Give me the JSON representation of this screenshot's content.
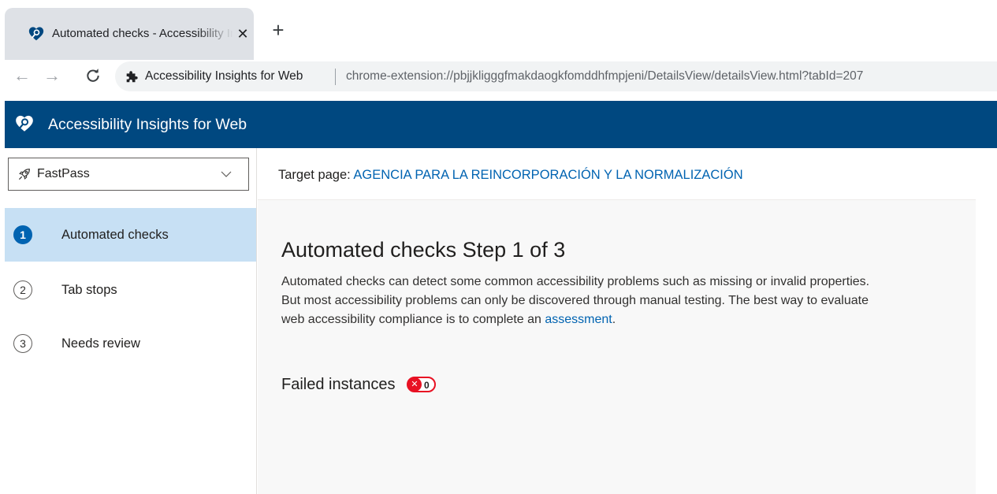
{
  "browser": {
    "tab": {
      "title": "Automated checks - Accessibility Insights for Web",
      "close": "✕",
      "favicon": "accessibility-insights-logo-icon"
    },
    "new_tab": "+",
    "nav": {
      "back": "←",
      "forward": "→",
      "reload": "C"
    },
    "omnibox": {
      "site_name": "Accessibility Insights for Web",
      "url": "chrome-extension://pbjjkligggfmakdaogkfomddhfmpjeni/DetailsView/detailsView.html?tabId=207",
      "icon": "puzzle-extension-icon"
    }
  },
  "app": {
    "title": "Accessibility Insights for Web",
    "header_color": "#004880"
  },
  "sidebar": {
    "dropdown": {
      "label": "FastPass",
      "icon": "rocket-icon"
    },
    "items": [
      {
        "number": "1",
        "label": "Automated checks",
        "selected": true
      },
      {
        "number": "2",
        "label": "Tab stops",
        "selected": false
      },
      {
        "number": "3",
        "label": "Needs review",
        "selected": false
      }
    ]
  },
  "target": {
    "prefix": "Target page: ",
    "link": "AGENCIA PARA LA REINCORPORACIÓN Y LA NORMALIZACIÓN"
  },
  "main": {
    "title": "Automated checks Step 1 of 3",
    "description": "Automated checks can detect some common accessibility problems such as missing or invalid properties. But most accessibility problems can only be discovered through manual testing. The best way to evaluate web accessibility compliance is to complete an ",
    "assessment_link": "assessment",
    "description_end": ".",
    "failed_label": "Failed instances",
    "failed_count": "0",
    "failed_icon": "✕"
  },
  "colors": {
    "accent": "#0063b1",
    "selected_bg": "#c7e0f4",
    "error": "#e81123"
  }
}
